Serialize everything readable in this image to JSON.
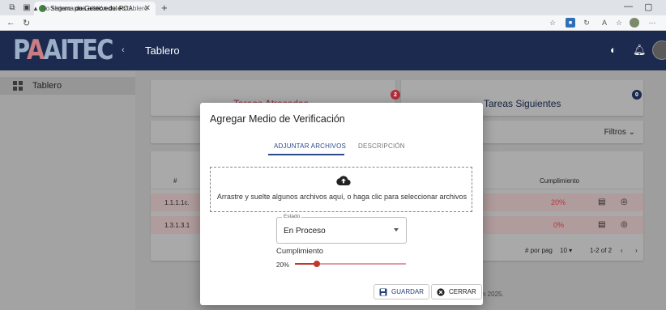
{
  "browser": {
    "tab_title": "Sistema de Gestión del POA",
    "new_tab": "+",
    "url_warning": "No seguro",
    "url_host": "poa.aitec.edu.ec",
    "url_path": "/tablero"
  },
  "app": {
    "logo_text_1": "P",
    "logo_text_2": "A",
    "logo_text_3": "AITEC",
    "page_title": "Tablero"
  },
  "sidebar": {
    "items": [
      {
        "label": "Tablero",
        "icon": "dashboard-icon"
      }
    ]
  },
  "cards": {
    "late_title": "Tareas Atrasadas",
    "late_count": "2",
    "next_title": "Tareas Siguientes",
    "next_count": "0",
    "filters_label": "Filtros"
  },
  "table": {
    "col_index": "#",
    "col_cumplimiento": "Cumplimiento",
    "rows": [
      {
        "id": "1.1.1.1c.",
        "pct": "20%"
      },
      {
        "id": "1.3.1.3.1",
        "pct": "0%"
      }
    ],
    "per_page_label": "# por pag",
    "per_page_value": "10",
    "range": "1-2 of 2"
  },
  "footer_text": "n 2025.",
  "modal": {
    "title": "Agregar Medio de Verificación",
    "tab_files": "ADJUNTAR ARCHIVOS",
    "tab_description": "DESCRIPCIÓN",
    "dropzone_text": "Arrastre y suelte algunos archivos aquí, o haga clic para seleccionar archivos",
    "estado_label": "Estado",
    "estado_value": "En Proceso",
    "cumplimiento_label": "Cumplimiento",
    "cumplimiento_value": 20,
    "cumplimiento_display": "20%",
    "save_label": "GUARDAR",
    "close_label": "CERRAR"
  },
  "colors": {
    "header_bg": "#1b2a4e",
    "accent_red": "#c0392b",
    "primary_blue": "#2c4a8a"
  }
}
